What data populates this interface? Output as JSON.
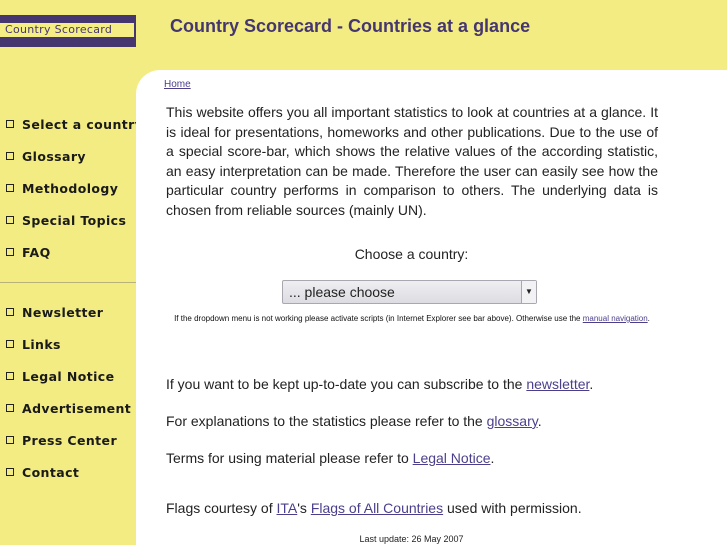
{
  "logo": {
    "text": "Country Scorecard"
  },
  "header": {
    "title": "Country Scorecard - Countries at a glance"
  },
  "colors": {
    "background": "#f2ec82",
    "brand_purple": "#463670",
    "link": "#4b3f8c"
  },
  "sidebar": {
    "primary": [
      {
        "label": "Select a country"
      },
      {
        "label": "Glossary"
      },
      {
        "label": "Methodology"
      },
      {
        "label": "Special Topics"
      },
      {
        "label": "FAQ"
      }
    ],
    "secondary": [
      {
        "label": "Newsletter"
      },
      {
        "label": "Links"
      },
      {
        "label": "Legal Notice"
      },
      {
        "label": "Advertisement"
      },
      {
        "label": "Press Center"
      },
      {
        "label": "Contact"
      }
    ]
  },
  "breadcrumb": {
    "home": "Home"
  },
  "intro": "This website offers you all important statistics to look at countries at a glance. It is ideal for presentations, homeworks and other publications. Due to the use of a special score-bar, which shows the relative values of the according statistic, an easy interpretation can be made. Therefore the user can easily see how the particular country performs in comparison to others. The underlying data is chosen from reliable sources (mainly UN).",
  "chooser": {
    "label": "Choose a country:",
    "selected": "... please choose",
    "note_before": "If the dropdown menu is not working please activate scripts (in Internet Explorer  see bar above). Otherwise use the ",
    "note_link": "manual navigation",
    "note_after": "."
  },
  "paragraphs": {
    "newsletter": {
      "before": "If you want to be kept up-to-date you can subscribe to the ",
      "link": "newsletter",
      "after": "."
    },
    "glossary": {
      "before": "For explanations to the statistics please refer to the ",
      "link": "glossary",
      "after": "."
    },
    "legal": {
      "before": "Terms for using material please refer to ",
      "link": "Legal Notice",
      "after": "."
    },
    "flags": {
      "before": "Flags courtesy of ",
      "link1": "ITA",
      "middle": "'s ",
      "link2": "Flags of All Countries",
      "after": " used with permission."
    }
  },
  "footer": {
    "last_update": "Last update: 26 May 2007"
  }
}
